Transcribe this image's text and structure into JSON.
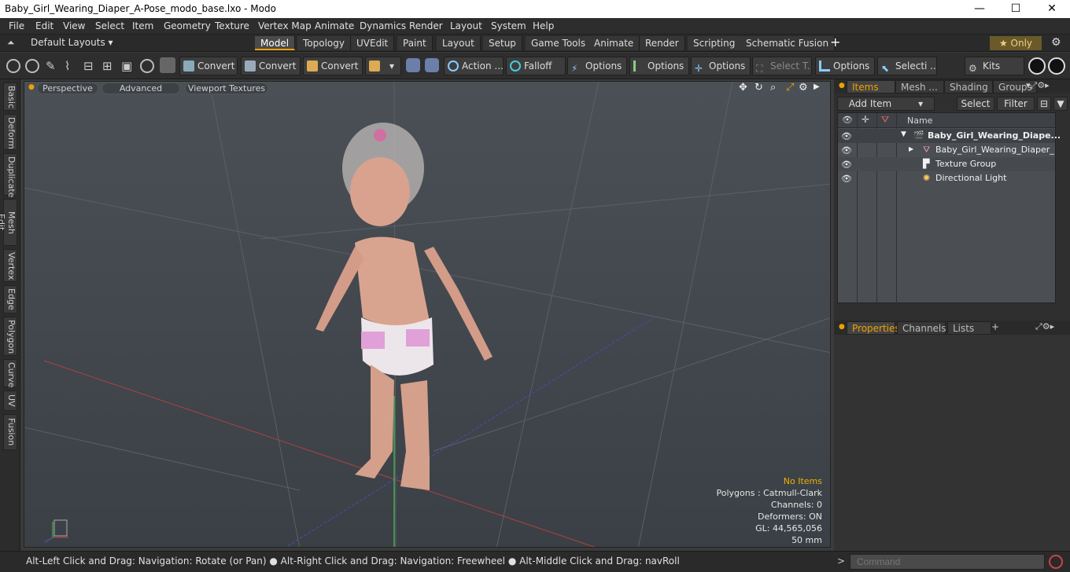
{
  "window": {
    "title": "Baby_Girl_Wearing_Diaper_A-Pose_modo_base.lxo - Modo",
    "minimize": "—",
    "maximize": "☐",
    "close": "✕"
  },
  "menu": [
    "File",
    "Edit",
    "View",
    "Select",
    "Item",
    "Geometry",
    "Texture",
    "Vertex Map",
    "Animate",
    "Dynamics",
    "Render",
    "Layout",
    "System",
    "Help"
  ],
  "layouts": {
    "dropdown": "Default Layouts ▾",
    "tabs": [
      "Model",
      "Topology",
      "UVEdit",
      "Paint",
      "Layout",
      "Setup",
      "Game Tools",
      "Animate",
      "Render",
      "Scripting",
      "Schematic Fusion"
    ],
    "active": "Model",
    "add": "+",
    "only": "★ Only"
  },
  "toolbar": {
    "convert1": "Convert",
    "convert2": "Convert",
    "convert3": "Convert",
    "action": "Action ...",
    "falloff": "Falloff",
    "options1": "Options",
    "options2": "Options",
    "options3": "Options",
    "select_t": "Select T...",
    "options4": "Options",
    "selecti": "Selecti ...",
    "kits": "Kits"
  },
  "lefttabs": [
    "Basic",
    "Deform",
    "Duplicate",
    "Mesh Edit",
    "Vertex",
    "Edge",
    "Polygon",
    "Curve",
    "UV",
    "Fusion"
  ],
  "viewport": {
    "perspective": "Perspective",
    "advanced": "Advanced",
    "textures": "Viewport Textures",
    "info": {
      "no_items": "No Items",
      "polygons": "Polygons : Catmull-Clark",
      "channels": "Channels: 0",
      "deformers": "Deformers: ON",
      "gl": "GL: 44,565,056",
      "mm": "50 mm"
    }
  },
  "items_panel": {
    "tabs": [
      "Items",
      "Mesh ...",
      "Shading",
      "Groups"
    ],
    "add_item": "Add Item",
    "select": "Select",
    "filter": "Filter",
    "name_col": "Name",
    "rows": [
      "Baby_Girl_Wearing_Diape...",
      "Baby_Girl_Wearing_Diaper_ ...",
      "Texture Group",
      "Directional Light"
    ]
  },
  "props_panel": {
    "tabs": [
      "Properties",
      "Channels",
      "Lists"
    ],
    "add": "+"
  },
  "status": {
    "message": "Alt-Left Click and Drag: Navigation: Rotate (or Pan) ● Alt-Right Click and Drag: Navigation: Freewheel ● Alt-Middle Click and Drag: navRoll",
    "command_placeholder": "Command",
    "prompt": ">"
  },
  "colors": {
    "accent": "#f0a000",
    "viewport": "#434a50"
  }
}
